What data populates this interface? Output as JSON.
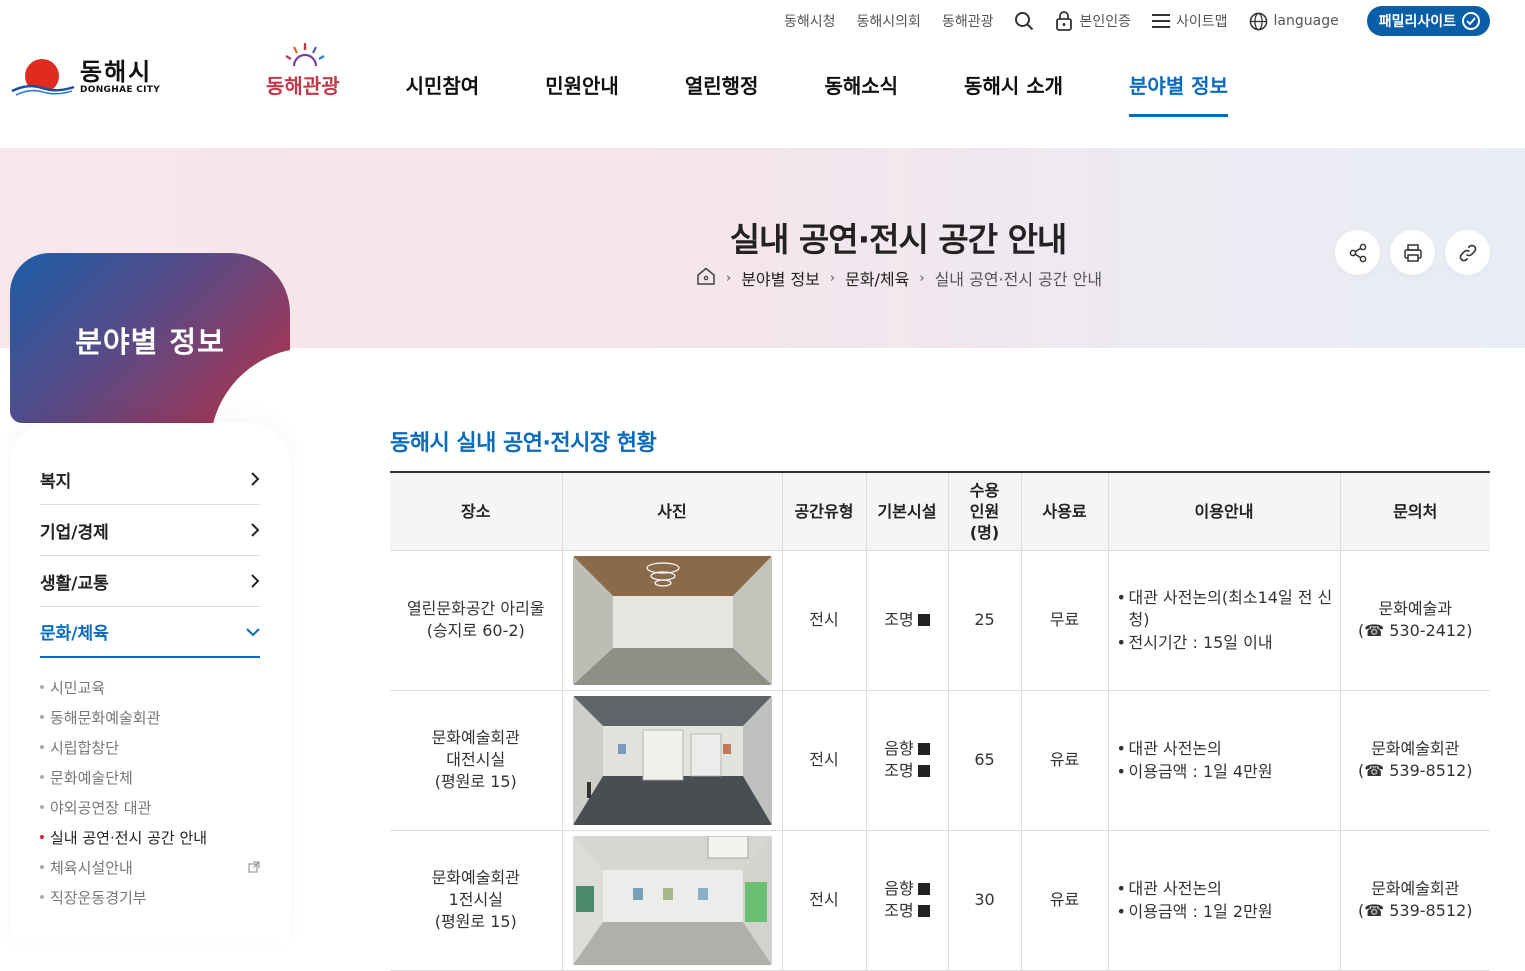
{
  "util": {
    "links": [
      "동해시청",
      "동해시의회",
      "동해관광"
    ],
    "auth": "본인인증",
    "sitemap": "사이트맵",
    "language": "language",
    "family": "패밀리사이트"
  },
  "logo": {
    "ko": "동해시",
    "en": "DONGHAE CITY"
  },
  "gnb": [
    "동해관광",
    "시민참여",
    "민원안내",
    "열린행정",
    "동해소식",
    "동해시 소개",
    "분야별 정보"
  ],
  "page": {
    "title": "실내 공연·전시 공간 안내",
    "breadcrumb": [
      "분야별 정보",
      "문화/체육",
      "실내 공연·전시 공간 안내"
    ]
  },
  "sidebar": {
    "title": "분야별 정보",
    "menu": [
      "복지",
      "기업/경제",
      "생활/교통",
      "문화/체육"
    ],
    "sub": [
      "시민교육",
      "동해문화예술회관",
      "시립합창단",
      "문화예술단체",
      "야외공연장 대관",
      "실내 공연·전시 공간 안내",
      "체육시설안내",
      "직장운동경기부"
    ]
  },
  "section": {
    "title": "동해시 실내 공연·전시장 현황"
  },
  "table": {
    "headers": [
      "장소",
      "사진",
      "공간유형",
      "기본시설",
      "수용\n인원\n(명)",
      "사용료",
      "이용안내",
      "문의처"
    ],
    "rows": [
      {
        "place": [
          "열린문화공간 아리울",
          "(승지로 60-2)"
        ],
        "type": "전시",
        "facilities": [
          "조명"
        ],
        "capacity": "25",
        "fee": "무료",
        "guide": [
          "대관 사전논의(최소14일 전 신청)",
          "전시기간 : 15일 이내"
        ],
        "contact": [
          "문화예술과",
          "(☎ 530-2412)"
        ]
      },
      {
        "place": [
          "문화예술회관",
          "대전시실",
          "(평원로 15)"
        ],
        "type": "전시",
        "facilities": [
          "음향",
          "조명"
        ],
        "capacity": "65",
        "fee": "유료",
        "guide": [
          "대관 사전논의",
          "이용금액 : 1일 4만원"
        ],
        "contact": [
          "문화예술회관",
          "(☎ 539-8512)"
        ]
      },
      {
        "place": [
          "문화예술회관",
          "1전시실",
          "(평원로 15)"
        ],
        "type": "전시",
        "facilities": [
          "음향",
          "조명"
        ],
        "capacity": "30",
        "fee": "유료",
        "guide": [
          "대관 사전논의",
          "이용금액 : 1일 2만원"
        ],
        "contact": [
          "문화예술회관",
          "(☎ 539-8512)"
        ]
      }
    ]
  }
}
